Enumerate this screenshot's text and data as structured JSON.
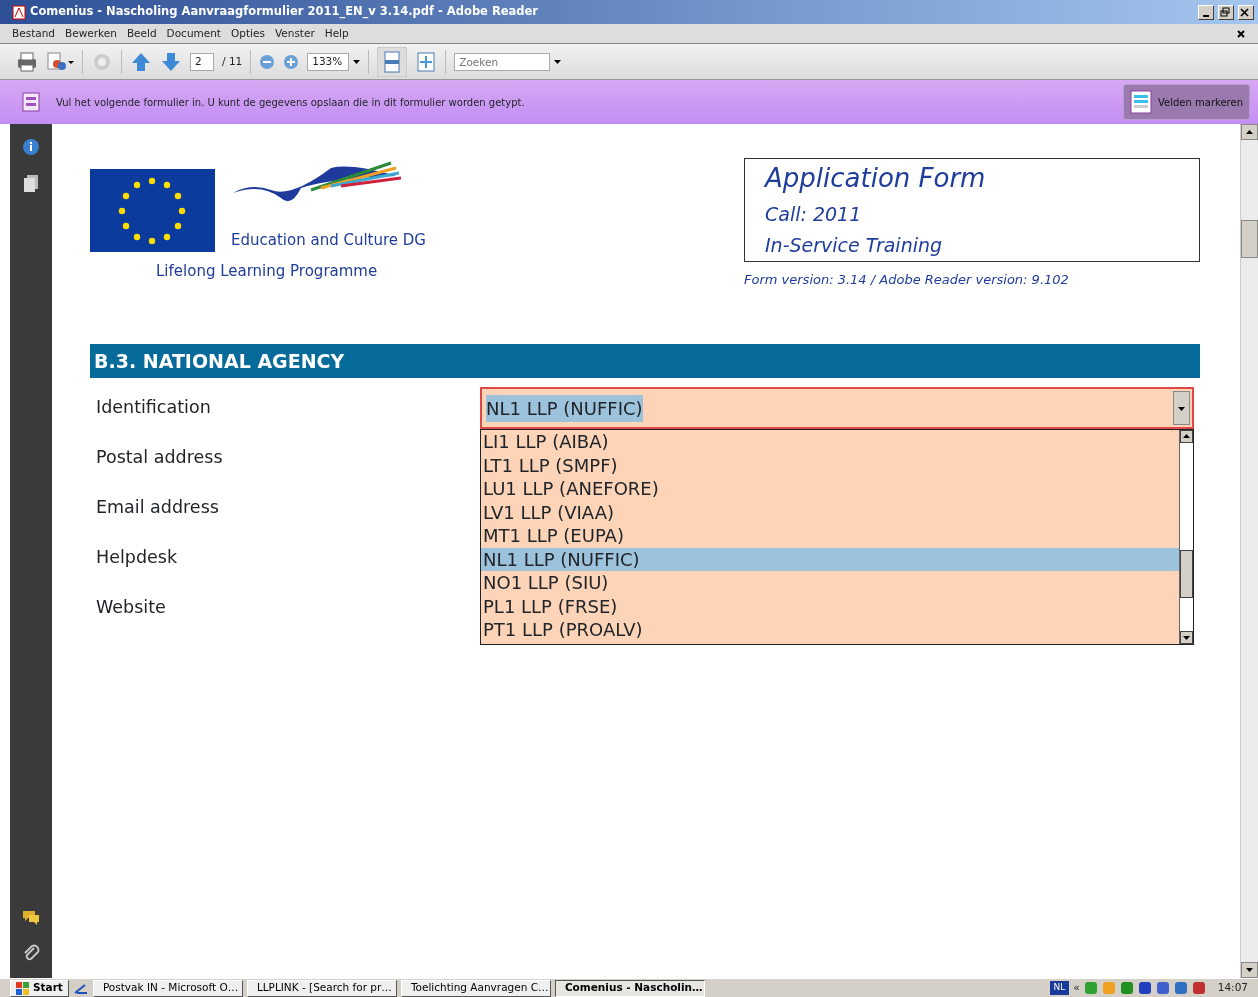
{
  "window": {
    "title": "Comenius - Nascholing Aanvraagformulier 2011_EN_v 3.14.pdf - Adobe Reader"
  },
  "menu": [
    "Bestand",
    "Bewerken",
    "Beeld",
    "Document",
    "Opties",
    "Venster",
    "Help"
  ],
  "toolbar": {
    "page": "2",
    "page_total": "/ 11",
    "zoom": "133%",
    "search": {
      "placeholder": "Zoeken"
    }
  },
  "notice": {
    "text": "Vul het volgende formulier in. U kunt de gegevens opslaan die in dit formulier worden getypt.",
    "button": "Velden markeren"
  },
  "document": {
    "logo": {
      "dg": "Education and Culture DG",
      "programme": "Lifelong Learning Programme"
    },
    "title_box": [
      "Application Form",
      "Call: 2011",
      "In-Service Training"
    ],
    "version": "Form version: 3.14 / Adobe Reader version: 9.102",
    "section": "B.3. NATIONAL AGENCY",
    "fields": [
      "Identification",
      "Postal address",
      "Email address",
      "Helpdesk",
      "Website"
    ],
    "dropdown": {
      "value": "NL1 LLP (NUFFIC)",
      "expanded": true,
      "options": [
        {
          "label": "LI1 LLP (AIBA)",
          "selected": false
        },
        {
          "label": "LT1 LLP (SMPF)",
          "selected": false
        },
        {
          "label": "LU1 LLP (ANEFORE)",
          "selected": false
        },
        {
          "label": "LV1 LLP (VIAA)",
          "selected": false
        },
        {
          "label": "MT1 LLP (EUPA)",
          "selected": false
        },
        {
          "label": "NL1 LLP (NUFFIC)",
          "selected": true
        },
        {
          "label": "NO1 LLP (SIU)",
          "selected": false
        },
        {
          "label": "PL1 LLP (FRSE)",
          "selected": false
        },
        {
          "label": "PT1 LLP (PROALV)",
          "selected": false
        }
      ]
    }
  },
  "taskbar": {
    "start": "Start",
    "tasks": [
      {
        "label": "Postvak IN - Microsoft O…",
        "selected": false
      },
      {
        "label": "LLPLINK - [Search for pr…",
        "selected": false
      },
      {
        "label": "Toelichting Aanvragen C…",
        "selected": false
      },
      {
        "label": "Comenius - Nascholin…",
        "selected": true
      }
    ],
    "language": "NL",
    "expand": "«",
    "clock": "14:07"
  }
}
